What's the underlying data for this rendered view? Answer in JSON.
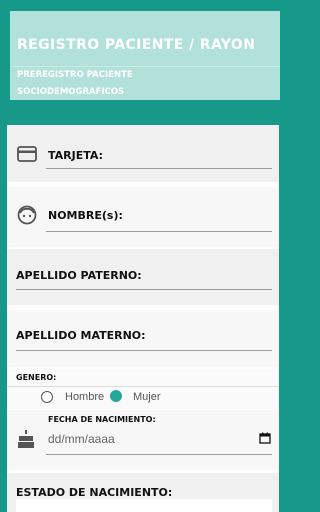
{
  "header": {
    "title": "REGISTRO PACIENTE / RAYON",
    "subtitle_1": "PREREGISTRO PACIENTE",
    "subtitle_2": "SOCIODEMOGRAFICOS"
  },
  "form": {
    "tarjeta_label": "TARJETA:",
    "nombre_label": "NOMBRE(s):",
    "apellido_paterno_label": "APELLIDO PATERNO:",
    "apellido_materno_label": "APELLIDO MATERNO:",
    "genero_label": "GENERO:",
    "genero_options": [
      "Hombre",
      "Mujer"
    ],
    "genero_selected": "Mujer",
    "fecha_label": "FECHA DE NACIMIENTO:",
    "fecha_placeholder": "dd/mm/aaaa",
    "estado_label": "ESTADO DE NACIMIENTO:"
  },
  "colors": {
    "background": "#17998a",
    "header": "#b2e1dc",
    "accent": "#26a69a"
  },
  "icons": [
    "credit-card-icon",
    "face-icon",
    "cake-icon",
    "calendar-icon"
  ]
}
